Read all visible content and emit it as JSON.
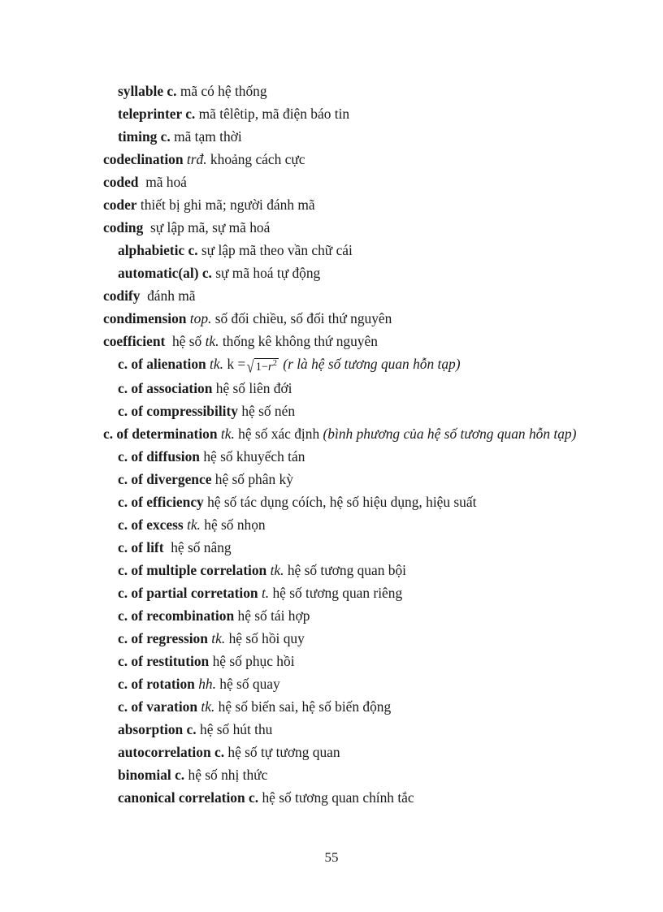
{
  "page": {
    "number": "55"
  },
  "entries": [
    {
      "indent": 1,
      "headword": "syllable c.",
      "abbr": "",
      "gloss": "mã có hệ thống"
    },
    {
      "indent": 1,
      "headword": "teleprinter c.",
      "abbr": "",
      "gloss": "mã têlêtip, mã điện báo tin"
    },
    {
      "indent": 1,
      "headword": "timing c.",
      "abbr": "",
      "gloss": "mã tạm thời"
    },
    {
      "indent": 0,
      "headword": "codeclination",
      "abbr": "trđ.",
      "gloss": "khoảng cách cực"
    },
    {
      "indent": 0,
      "headword": "coded",
      "abbr": "",
      "gloss": "mã hoá"
    },
    {
      "indent": 0,
      "headword": "coder",
      "abbr": "",
      "gloss": "thiết bị ghi mã; người đánh mã"
    },
    {
      "indent": 0,
      "headword": "coding",
      "abbr": "",
      "gloss": "sự lập mã, sự mã hoá"
    },
    {
      "indent": 1,
      "headword": "alphabietic c.",
      "abbr": "",
      "gloss": "sự lập mã theo vần chữ cái"
    },
    {
      "indent": 1,
      "headword": "automatic(al) c.",
      "abbr": "",
      "gloss": "sự mã hoá tự động"
    },
    {
      "indent": 0,
      "headword": "codify",
      "abbr": "",
      "gloss": "đánh mã"
    },
    {
      "indent": 0,
      "headword": "condimension",
      "abbr": "top.",
      "gloss": "số đối chiều, số đối thứ nguyên"
    },
    {
      "indent": 0,
      "headword": "coefficient",
      "abbr": "",
      "gloss_pre": "hệ số",
      "abbr2": "tk.",
      "gloss": "thống kê không thứ nguyên"
    },
    {
      "indent": 2,
      "headword": "c. of  alienation",
      "abbr": "tk.",
      "formula": {
        "lhs": "k =",
        "radicand_number": "1",
        "radicand_minus": "−",
        "radicand_var": "r",
        "radicand_exp": "2"
      },
      "note": "(r là hệ số tương quan hỗn tạp)"
    },
    {
      "indent": 2,
      "headword": "c. of association",
      "abbr": "",
      "gloss": "hệ số liên đới"
    },
    {
      "indent": 2,
      "headword": "c. of compressibility",
      "abbr": "",
      "gloss": "hệ số nén"
    },
    {
      "indent": 2,
      "headword": "c. of determination",
      "abbr": "tk.",
      "gloss": "hệ số xác định",
      "note": "(bình phương của hệ số tương quan hỗn tạp)",
      "wraps": true
    },
    {
      "indent": 2,
      "headword": "c. of diffusion",
      "abbr": "",
      "gloss": "hệ số khuyếch tán"
    },
    {
      "indent": 2,
      "headword": "c. of divergence",
      "abbr": "",
      "gloss": "hệ số phân kỳ"
    },
    {
      "indent": 2,
      "headword": "c. of efficiency",
      "abbr": "",
      "gloss": "hệ số tác dụng cóích, hệ số hiệu dụng, hiệu suất"
    },
    {
      "indent": 2,
      "headword": "c. of excess",
      "abbr": "tk.",
      "gloss": "hệ số nhọn"
    },
    {
      "indent": 2,
      "headword": "c. of lift",
      "abbr": "",
      "gloss": "hệ số nâng"
    },
    {
      "indent": 2,
      "headword": "c. of multiple correlation",
      "abbr": "tk.",
      "gloss": "hệ số tương quan bội"
    },
    {
      "indent": 2,
      "headword": "c. of partial corretation",
      "abbr": "t.",
      "gloss": "hệ số tương quan riêng"
    },
    {
      "indent": 2,
      "headword": "c. of recombination",
      "abbr": "",
      "gloss": "hệ số tái hợp"
    },
    {
      "indent": 2,
      "headword": "c. of regression",
      "abbr": "tk.",
      "gloss": "hệ số hồi quy"
    },
    {
      "indent": 2,
      "headword": "c. of restitution",
      "abbr": "",
      "gloss": "hệ số phục hồi"
    },
    {
      "indent": 2,
      "headword": "c. of rotation",
      "abbr": "hh.",
      "gloss": "hệ số quay"
    },
    {
      "indent": 2,
      "headword": "c. of varation",
      "abbr": "tk.",
      "gloss": "hệ số biến sai, hệ số biến động"
    },
    {
      "indent": 2,
      "headword": "absorption c.",
      "abbr": "",
      "gloss": "hệ số hút thu"
    },
    {
      "indent": 2,
      "headword": "autocorrelation c.",
      "abbr": "",
      "gloss": "hệ số tự tương quan"
    },
    {
      "indent": 2,
      "headword": "binomial c.",
      "abbr": "",
      "gloss": "hệ số nhị thức"
    },
    {
      "indent": 2,
      "headword": "canonical correlation c.",
      "abbr": "",
      "gloss": "hệ số tương quan chính tắc"
    }
  ]
}
